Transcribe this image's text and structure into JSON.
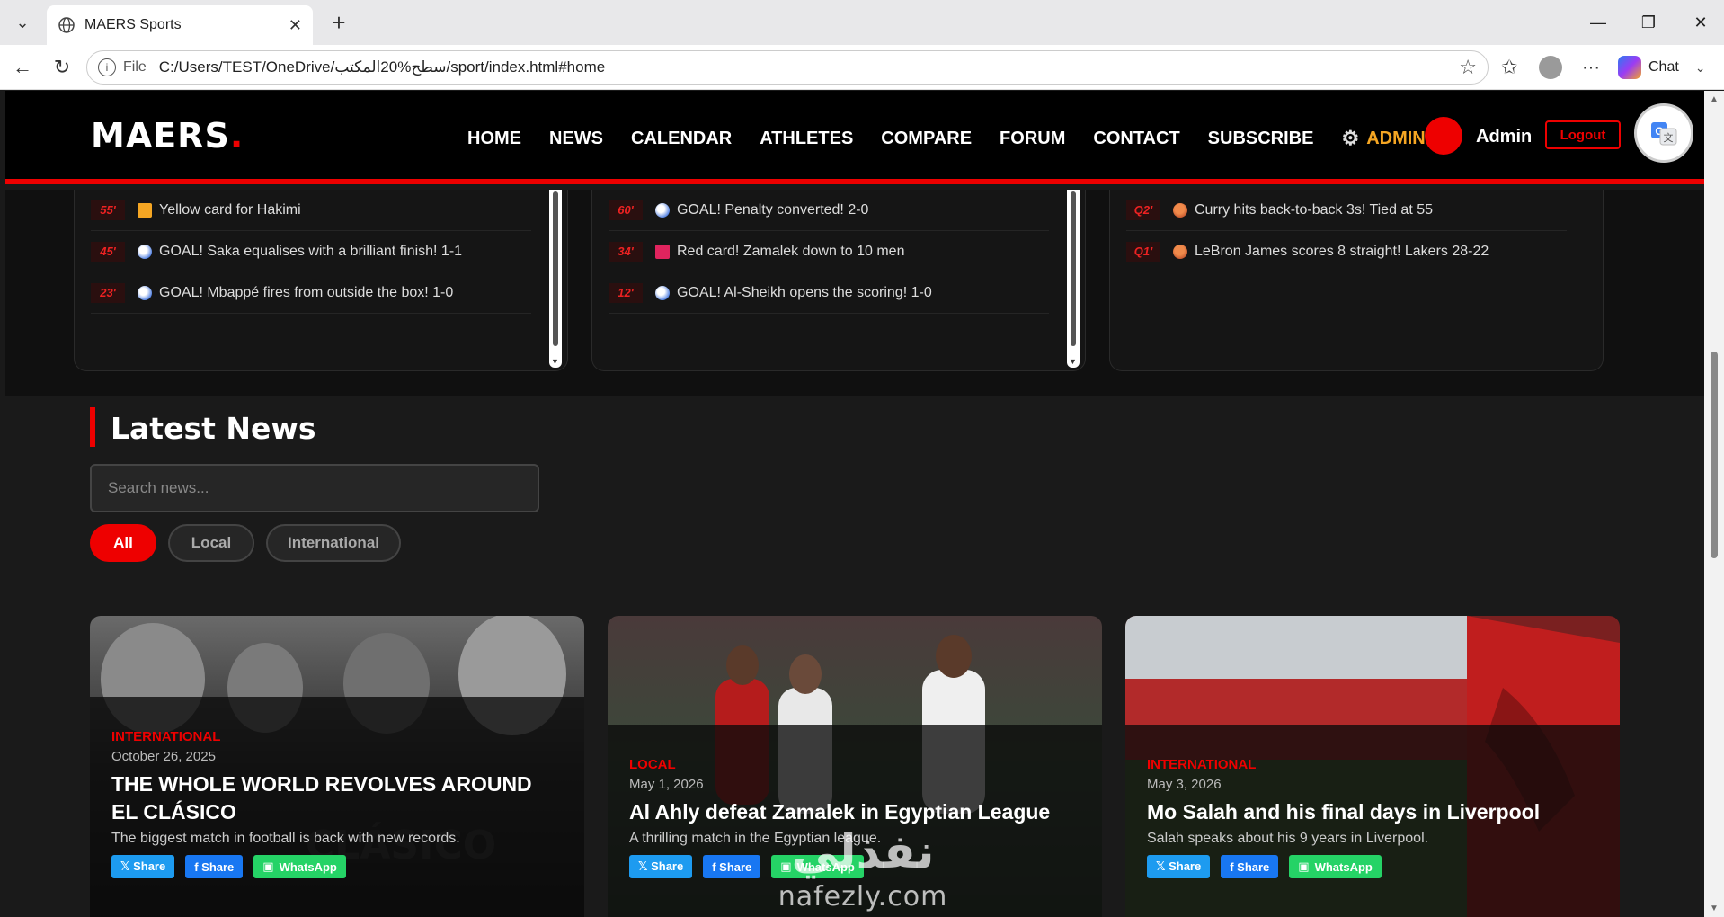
{
  "browser": {
    "tab_title": "MAERS Sports",
    "file_label": "File",
    "url": "C:/Users/TEST/OneDrive/سطح%20المكتب/sport/index.html#home",
    "chat_label": "Chat"
  },
  "site": {
    "logo_text": "MAERS",
    "logo_dot": ".",
    "nav": [
      "HOME",
      "NEWS",
      "CALENDAR",
      "ATHLETES",
      "COMPARE",
      "FORUM",
      "CONTACT",
      "SUBSCRIBE"
    ],
    "admin_link": "ADMIN",
    "user_name": "Admin",
    "logout_label": "Logout",
    "accent": "#e00000"
  },
  "live": {
    "cards": [
      {
        "events": [
          {
            "minute": "55'",
            "icon": "yellow-card",
            "text": "Yellow card for Hakimi"
          },
          {
            "minute": "45'",
            "icon": "football",
            "text": "GOAL! Saka equalises with a brilliant finish! 1-1"
          },
          {
            "minute": "23'",
            "icon": "football",
            "text": "GOAL! Mbappé fires from outside the box! 1-0"
          }
        ]
      },
      {
        "events": [
          {
            "minute": "60'",
            "icon": "football",
            "text": "GOAL! Penalty converted! 2-0"
          },
          {
            "minute": "34'",
            "icon": "red-card",
            "text": "Red card! Zamalek down to 10 men"
          },
          {
            "minute": "12'",
            "icon": "football",
            "text": "GOAL! Al-Sheikh opens the scoring! 1-0"
          }
        ]
      },
      {
        "events": [
          {
            "minute": "Q2'",
            "icon": "basketball",
            "text": "Curry hits back-to-back 3s! Tied at 55"
          },
          {
            "minute": "Q1'",
            "icon": "basketball",
            "text": "LeBron James scores 8 straight! Lakers 28-22"
          }
        ]
      }
    ]
  },
  "news": {
    "title": "Latest News",
    "search_placeholder": "Search news...",
    "filters": [
      "All",
      "Local",
      "International"
    ],
    "active_filter": "All",
    "share_labels": {
      "x": "𝕏 Share",
      "facebook": "f Share",
      "whatsapp": "WhatsApp"
    },
    "articles": [
      {
        "category": "INTERNATIONAL",
        "date": "October 26, 2025",
        "headline": "THE WHOLE WORLD REVOLVES AROUND EL CLÁSICO",
        "description": "The biggest match in football is back with new records."
      },
      {
        "category": "LOCAL",
        "date": "May 1, 2026",
        "headline": "Al Ahly defeat Zamalek in Egyptian League",
        "description": "A thrilling match in the Egyptian league."
      },
      {
        "category": "INTERNATIONAL",
        "date": "May 3, 2026",
        "headline": "Mo Salah and his final days in Liverpool",
        "description": "Salah speaks about his 9 years in Liverpool."
      }
    ]
  },
  "watermark": {
    "arabic": "نفذلي",
    "latin": "nafezly.com"
  }
}
